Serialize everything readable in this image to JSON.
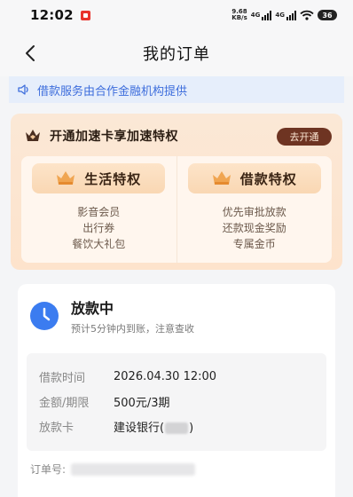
{
  "status_bar": {
    "time": "12:02",
    "net_speed_value": "9.68",
    "net_speed_unit": "KB/s",
    "signal1_label": "4G",
    "signal2_label": "4G",
    "battery": "36"
  },
  "nav": {
    "title": "我的订单"
  },
  "notice": {
    "text": "借款服务由合作金融机构提供"
  },
  "privilege": {
    "title": "开通加速卡享加速特权",
    "open_button": "去开通",
    "life": {
      "label": "生活特权",
      "items": [
        "影音会员",
        "出行券",
        "餐饮大礼包"
      ]
    },
    "loan": {
      "label": "借款特权",
      "items": [
        "优先审批放款",
        "还款现金奖励",
        "专属金币"
      ]
    }
  },
  "order": {
    "status_title": "放款中",
    "status_sub": "预计5分钟内到账，注意查收",
    "rows": [
      {
        "key": "借款时间",
        "value": "2026.04.30 12:00"
      },
      {
        "key": "金额/期限",
        "value": "500元/3期"
      },
      {
        "key": "放款卡",
        "value_prefix": "建设银行(",
        "value_suffix": ")"
      }
    ],
    "order_no_label": "订单号:"
  },
  "colors": {
    "accent_blue": "#3d6ddc",
    "brown_button": "#6e3422",
    "card_gold": "#fde3cc"
  }
}
